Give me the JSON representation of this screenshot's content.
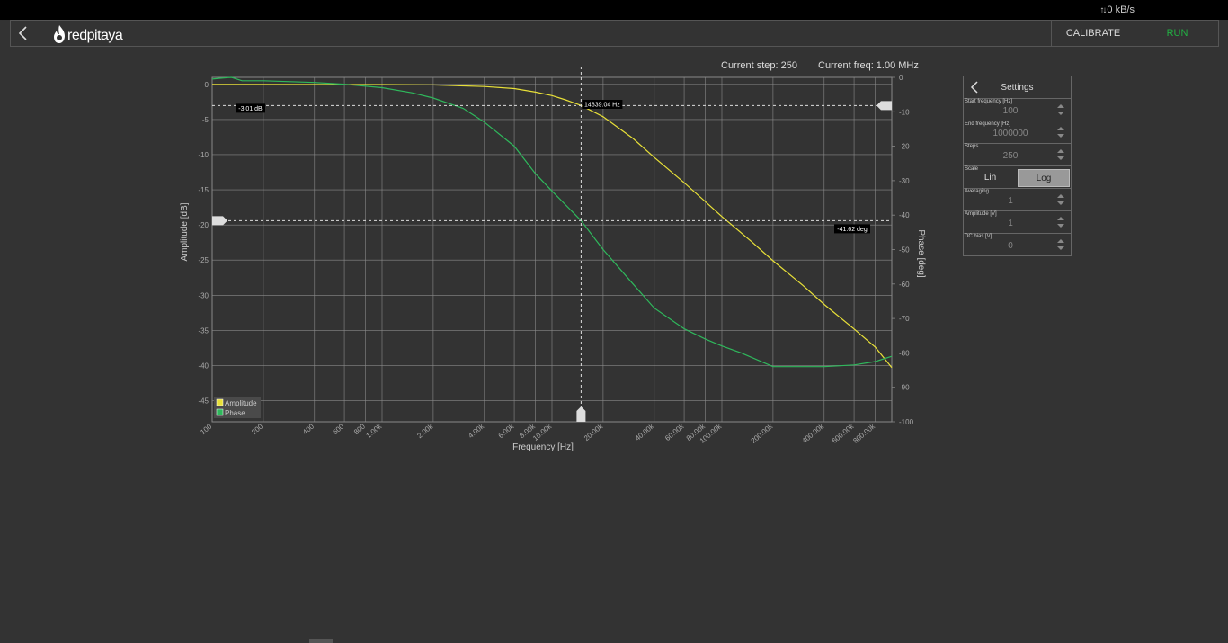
{
  "header": {
    "speed": "0 kB/s",
    "logo_text": "redpitaya",
    "calibrate_label": "CALIBRATE",
    "run_label": "RUN"
  },
  "status": {
    "current_step": "Current step: 250",
    "current_freq": "Current freq: 1.00 MHz"
  },
  "settings": {
    "title": "Settings",
    "fields": [
      {
        "label": "Start frequency [Hz]",
        "value": "100"
      },
      {
        "label": "End frequency [Hz]",
        "value": "1000000"
      },
      {
        "label": "Steps",
        "value": "250"
      }
    ],
    "scale": {
      "label": "Scale",
      "options": [
        "Lin",
        "Log"
      ],
      "selected": "Log"
    },
    "fields2": [
      {
        "label": "Averaging",
        "value": "1"
      },
      {
        "label": "Amplitude [V]",
        "value": "1"
      },
      {
        "label": "DC bias [V]",
        "value": "0"
      }
    ]
  },
  "chart_data": {
    "type": "line",
    "xlabel": "Frequency [Hz]",
    "ylabel": "Amplitude [dB]",
    "y2label": "Phase [deg]",
    "xscale": "log",
    "xlim": [
      100,
      1000000
    ],
    "ylim": [
      -48,
      1
    ],
    "y2lim": [
      -100,
      0
    ],
    "xticks": [
      100,
      200,
      400,
      600,
      800,
      1000,
      2000,
      4000,
      6000,
      8000,
      10000,
      20000,
      40000,
      60000,
      80000,
      100000,
      200000,
      400000,
      600000,
      800000
    ],
    "xticklabels": [
      "100",
      "200",
      "400",
      "600",
      "800",
      "1.00k",
      "2.00k",
      "4.00k",
      "6.00k",
      "8.00k",
      "10.00k",
      "20.00k",
      "40.00k",
      "60.00k",
      "80.00k",
      "100.00k",
      "200.00k",
      "400.00k",
      "600.00k",
      "800.00k"
    ],
    "yticks": [
      0,
      -5,
      -10,
      -15,
      -20,
      -25,
      -30,
      -35,
      -40,
      -45
    ],
    "y2ticks": [
      0,
      -10,
      -20,
      -30,
      -40,
      -50,
      -60,
      -70,
      -80,
      -90,
      -100
    ],
    "grid": true,
    "legend_position": "bottom-left",
    "series": [
      {
        "name": "Amplitude",
        "color": "#e8e038",
        "axis": "left",
        "x": [
          100,
          1000,
          2000,
          4000,
          6000,
          8000,
          10000,
          12000,
          14839,
          20000,
          30000,
          40000,
          60000,
          80000,
          100000,
          150000,
          200000,
          300000,
          400000,
          600000,
          800000,
          1000000
        ],
        "y": [
          0,
          -0.02,
          -0.08,
          -0.3,
          -0.6,
          -1.1,
          -1.6,
          -2.2,
          -3.01,
          -4.6,
          -7.7,
          -10.4,
          -14.0,
          -16.7,
          -18.8,
          -22.4,
          -25.1,
          -28.6,
          -31.3,
          -34.8,
          -37.4,
          -40.3
        ]
      },
      {
        "name": "Phase",
        "color": "#2fb85c",
        "axis": "right",
        "x": [
          100,
          110,
          130,
          150,
          200,
          400,
          600,
          1000,
          1500,
          2000,
          3000,
          4000,
          6000,
          8000,
          10000,
          14839,
          20000,
          30000,
          40000,
          60000,
          80000,
          100000,
          130000,
          200000,
          400000,
          600000,
          800000,
          1000000
        ],
        "y": [
          -0.5,
          -0.3,
          0,
          -1,
          -1,
          -1.5,
          -2,
          -3,
          -4.5,
          -6,
          -9,
          -13,
          -20,
          -28,
          -33,
          -41.62,
          -50,
          -60,
          -67,
          -73,
          -76,
          -78,
          -80,
          -84,
          -84,
          -83.5,
          -82.5,
          -81
        ]
      }
    ],
    "cursors": {
      "x": {
        "value": 14839.04,
        "label": "14839.04 Hz"
      },
      "y_amplitude": {
        "value": -3.01,
        "label": "-3.01 dB"
      },
      "y_phase": {
        "value": -41.62,
        "label": "-41.62 deg"
      }
    }
  }
}
